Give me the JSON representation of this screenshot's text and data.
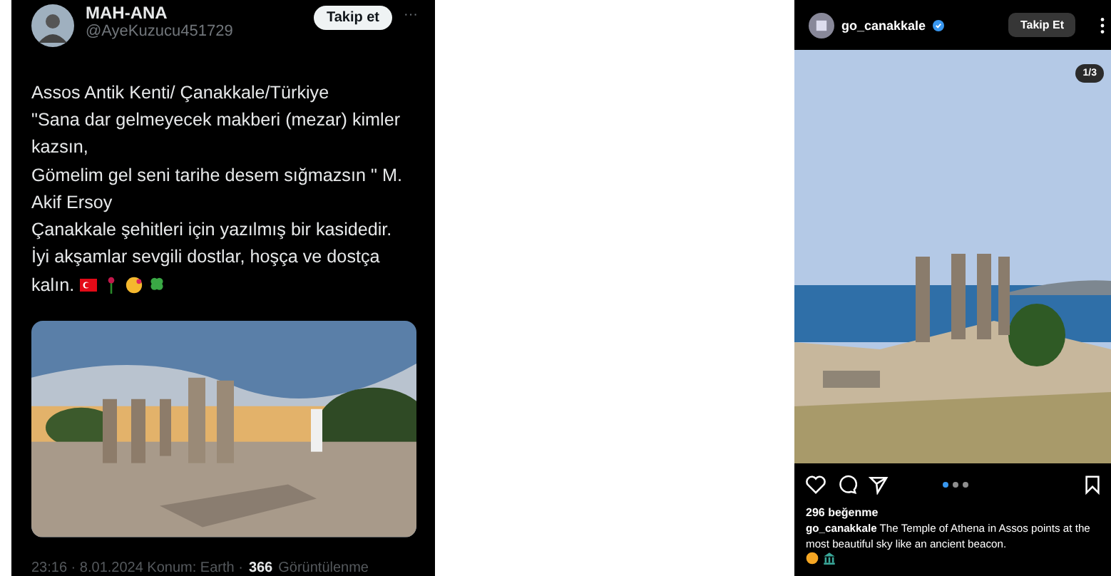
{
  "tweet": {
    "display_name": "MAH-ANA",
    "handle": "@AyeKuzucu451729",
    "follow_button": "Takip et",
    "more": "···",
    "text_lines": [
      "Assos Antik Kenti/ Çanakkale/Türkiye",
      "\"Sana dar gelmeyecek makberi (mezar) kimler",
      "kazsın,",
      "Gömelim gel seni tarihe desem sığmazsın \" M.",
      "Akif Ersoy",
      "Çanakkale şehitleri için yazılmış bir kasidedir.",
      "İyi akşamlar sevgili dostlar, hoşça ve dostça"
    ],
    "last_line": "kalın.",
    "emojis": [
      {
        "kind": "flag"
      },
      {
        "kind": "flower"
      },
      {
        "kind": "kiss"
      },
      {
        "kind": "clover"
      }
    ],
    "meta": "23:16 · 8.01.2024 Konum: Earth ·",
    "views": "366",
    "views_label": "Görüntülenme"
  },
  "post": {
    "username": "go_canakkale",
    "verified": true,
    "follow_button": "Takip Et",
    "counter": "1/3",
    "dots": [
      {
        "selected": true
      },
      {
        "selected": false
      },
      {
        "selected": false
      }
    ],
    "likes": "296 beğenme",
    "caption_user": "go_canakkale",
    "caption": "The Temple of Athena in Assos points at the most beautiful sky like an ancient beacon.",
    "caption_emojis": [
      {
        "kind": "face"
      },
      {
        "kind": "temple"
      }
    ]
  }
}
